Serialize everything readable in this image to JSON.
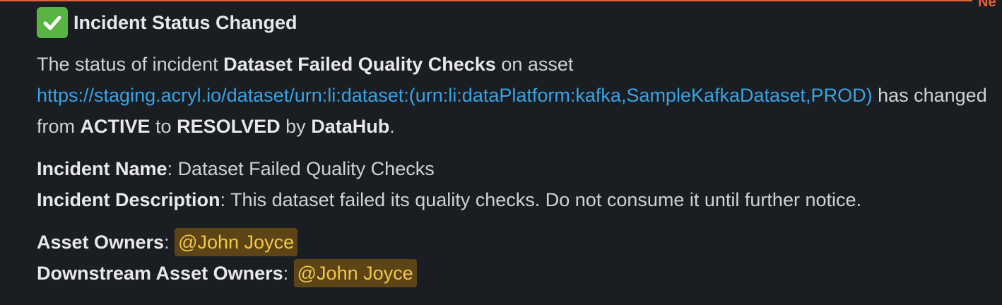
{
  "divider": {
    "label": "Ne",
    "color": "#e0603a"
  },
  "message": {
    "status_icon": "check-mark-button-icon",
    "title": "Incident Status Changed",
    "body": {
      "prefix": "The status of incident",
      "incident_name": "Dataset Failed Quality Checks",
      "on_asset": "on asset",
      "asset_url": "https://staging.acryl.io/dataset/urn:li:dataset:(urn:li:dataPlatform:kafka,SampleKafkaDataset,PROD)",
      "has_changed_from": "has changed from",
      "from_status": "ACTIVE",
      "to": "to",
      "to_status": "RESOLVED",
      "by": "by",
      "actor": "DataHub",
      "period": "."
    },
    "details": {
      "name_label": "Incident Name",
      "name_value": "Dataset Failed Quality Checks",
      "description_label": "Incident Description",
      "description_value": "This dataset failed its quality checks. Do not consume it until further notice."
    },
    "owners": {
      "asset_owners_label": "Asset Owners",
      "asset_owners_mention": "@John Joyce",
      "downstream_owners_label": "Downstream Asset Owners",
      "downstream_owners_mention": "@John Joyce"
    },
    "colors": {
      "link": "#3aa3e3",
      "mention_bg": "#5c4417",
      "mention_text": "#f2c744",
      "background": "#1a1d21"
    }
  }
}
